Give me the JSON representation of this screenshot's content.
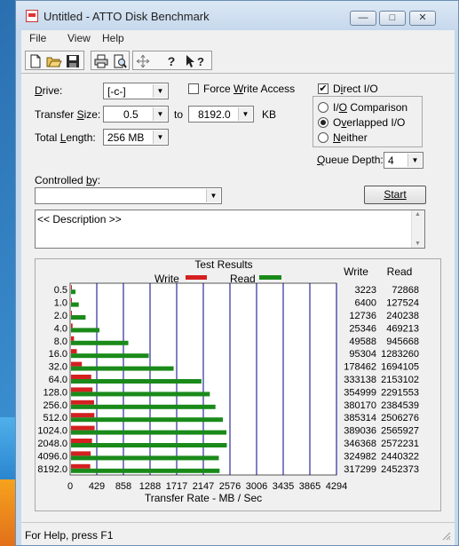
{
  "window": {
    "title": "Untitled - ATTO Disk Benchmark",
    "minimize": "—",
    "maximize": "□",
    "close": "✕"
  },
  "menu": [
    "File",
    "View",
    "Help"
  ],
  "toolbar": [
    "new-icon",
    "open-icon",
    "save-icon",
    "print-icon",
    "print-preview-icon",
    "move-icon",
    "help-icon",
    "context-help-icon"
  ],
  "form": {
    "drive_label": "Drive:",
    "drive_value": "[-c-]",
    "force_write_label": "Force Write Access",
    "force_write_checked": false,
    "direct_io_label": "Direct I/O",
    "direct_io_checked": true,
    "transfer_size_label": "Transfer Size:",
    "transfer_from": "0.5",
    "to_label": "to",
    "transfer_to": "8192.0",
    "kb_label": "KB",
    "total_length_label": "Total Length:",
    "total_length_value": "256 MB",
    "io_comparison_label": "I/O Comparison",
    "overlapped_io_label": "Overlapped I/O",
    "neither_label": "Neither",
    "selected_mode": "Overlapped I/O",
    "queue_depth_label": "Queue Depth:",
    "queue_depth_value": "4",
    "controlled_by_label": "Controlled by:",
    "controlled_by_value": "",
    "start_label": "Start",
    "description": "<< Description >>"
  },
  "status": "For Help, press F1",
  "colors": {
    "write": "#d42020",
    "read": "#1a8a1a",
    "grid": "#00008b"
  },
  "chart_data": {
    "type": "bar",
    "title": "Test Results",
    "xlabel": "Transfer Rate - MB / Sec",
    "xlim": [
      0,
      4294
    ],
    "xticks": [
      "0",
      "429",
      "858",
      "1288",
      "1717",
      "2147",
      "2576",
      "3006",
      "3435",
      "3865",
      "4294"
    ],
    "categories": [
      "0.5",
      "1.0",
      "2.0",
      "4.0",
      "8.0",
      "16.0",
      "32.0",
      "64.0",
      "128.0",
      "256.0",
      "512.0",
      "1024.0",
      "2048.0",
      "4096.0",
      "8192.0"
    ],
    "legend": [
      "Write",
      "Read"
    ],
    "table_headers": [
      "Write",
      "Read"
    ],
    "series": [
      {
        "name": "Write",
        "values": [
          3223,
          6400,
          12736,
          25346,
          49588,
          95304,
          178462,
          333138,
          354999,
          380170,
          385314,
          389036,
          346368,
          324982,
          317299
        ]
      },
      {
        "name": "Read",
        "values": [
          72868,
          127524,
          240238,
          469213,
          945668,
          1283260,
          1694105,
          2153102,
          2291553,
          2384539,
          2506276,
          2565927,
          2572231,
          2440322,
          2452373
        ]
      }
    ],
    "value_units_note_shown": false
  }
}
